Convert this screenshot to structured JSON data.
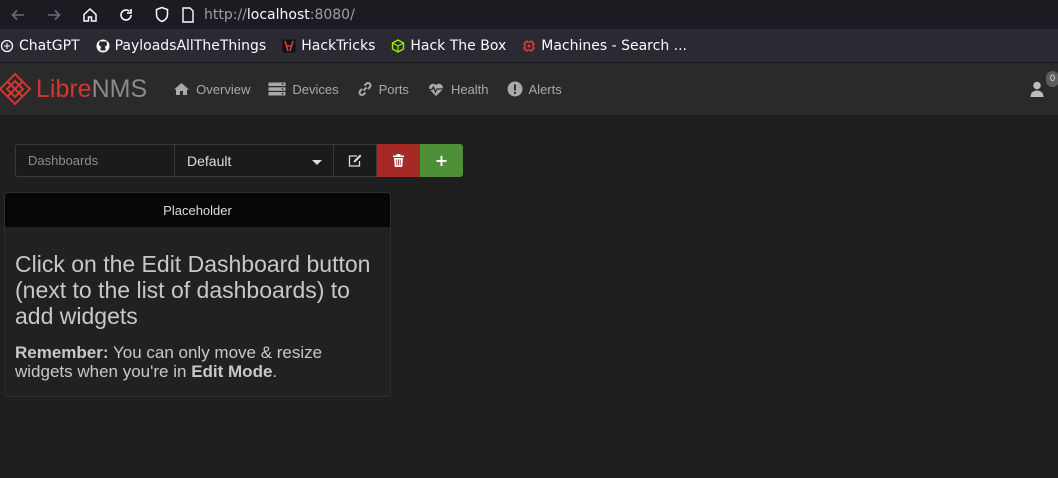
{
  "browser": {
    "url_prefix": "http://",
    "url_host": "localhost",
    "url_suffix": ":8080/",
    "bookmarks": [
      {
        "label": "ChatGPT",
        "icon": "chatgpt-icon"
      },
      {
        "label": "PayloadsAllTheThings",
        "icon": "github-icon"
      },
      {
        "label": "HackTricks",
        "icon": "hacktricks-icon"
      },
      {
        "label": "Hack The Box",
        "icon": "hackthebox-icon"
      },
      {
        "label": "Machines - Search ...",
        "icon": "machines-icon"
      }
    ]
  },
  "app": {
    "logo_libre": "Libre",
    "logo_nms": "NMS",
    "nav": [
      {
        "label": "Overview",
        "icon": "home-icon"
      },
      {
        "label": "Devices",
        "icon": "server-icon"
      },
      {
        "label": "Ports",
        "icon": "link-icon"
      },
      {
        "label": "Health",
        "icon": "heartbeat-icon"
      },
      {
        "label": "Alerts",
        "icon": "exclamation-circle-icon"
      }
    ],
    "notification_count": "0",
    "colors": {
      "brand_red": "#d23630",
      "delete": "#a52a25",
      "add": "#4e8f38"
    }
  },
  "dashboard": {
    "label": "Dashboards",
    "selected": "Default",
    "add_symbol": "+"
  },
  "widget": {
    "title": "Placeholder",
    "heading": "Click on the Edit Dashboard button (next to the list of dashboards) to add widgets",
    "remember_label": "Remember:",
    "remember_text": " You can only move & resize widgets when you're in ",
    "edit_mode": "Edit Mode",
    "period": "."
  }
}
